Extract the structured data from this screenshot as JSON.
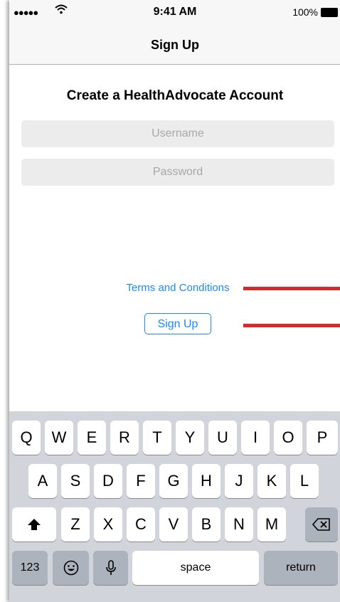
{
  "status": {
    "signal": "●●●●●",
    "time": "9:41 AM",
    "battery": "100%"
  },
  "nav": {
    "title": "Sign Up"
  },
  "form": {
    "heading": "Create a HealthAdvocate Account",
    "username_placeholder": "Username",
    "password_placeholder": "Password",
    "terms_link": "Terms and Conditions",
    "signup_button": "Sign Up"
  },
  "keyboard": {
    "row1": [
      "Q",
      "W",
      "E",
      "R",
      "T",
      "Y",
      "U",
      "I",
      "O",
      "P"
    ],
    "row2": [
      "A",
      "S",
      "D",
      "F",
      "G",
      "H",
      "J",
      "K",
      "L"
    ],
    "row3": [
      "Z",
      "X",
      "C",
      "V",
      "B",
      "N",
      "M"
    ],
    "numbers_key": "123",
    "space_key": "space",
    "return_key": "return",
    "shift_icon": "shift-icon",
    "backspace_icon": "backspace-icon",
    "emoji_icon": "emoji-icon",
    "mic_icon": "microphone-icon"
  },
  "colors": {
    "accent": "#1a8af5",
    "annotation": "#d62b2b",
    "keyboard_bg": "#d1d5db"
  }
}
